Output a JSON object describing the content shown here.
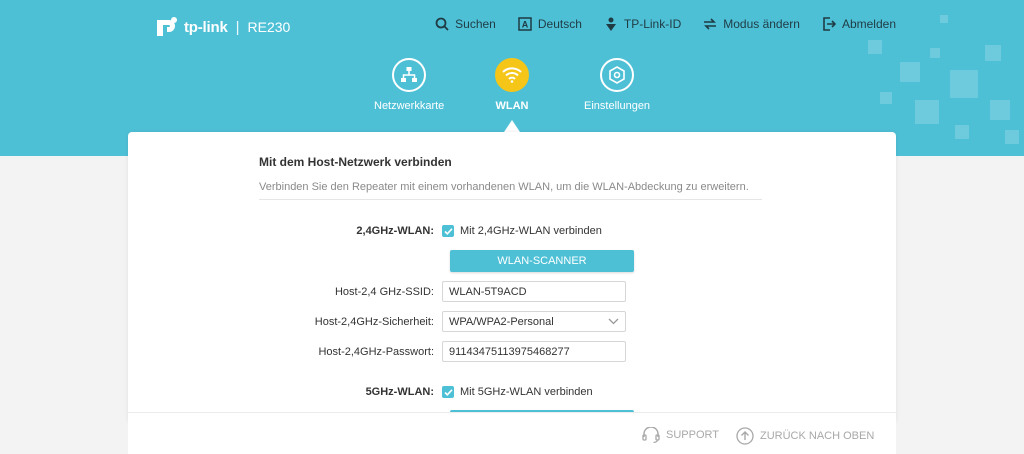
{
  "brand": {
    "logo_text": "tp-link",
    "separator": "|",
    "model": "RE230"
  },
  "top_nav": [
    {
      "label": "Suchen",
      "icon": "search-icon"
    },
    {
      "label": "Deutsch",
      "icon": "language-icon"
    },
    {
      "label": "TP-Link-ID",
      "icon": "tplink-id-icon"
    },
    {
      "label": "Modus ändern",
      "icon": "mode-change-icon"
    },
    {
      "label": "Abmelden",
      "icon": "logout-icon"
    }
  ],
  "main_nav": [
    {
      "label": "Netzwerkkarte",
      "icon": "network-map-icon",
      "active": false
    },
    {
      "label": "WLAN",
      "icon": "wifi-icon",
      "active": true
    },
    {
      "label": "Einstellungen",
      "icon": "settings-icon",
      "active": false
    }
  ],
  "section": {
    "title": "Mit dem Host-Netzwerk verbinden",
    "description": "Verbinden Sie den Repeater mit einem vorhandenen WLAN, um die WLAN-Abdeckung zu erweitern."
  },
  "band24": {
    "label": "2,4GHz-WLAN:",
    "checkbox_label": "Mit 2,4GHz-WLAN verbinden",
    "checked": true,
    "scanner_button": "WLAN-SCANNER",
    "ssid_label": "Host-2,4 GHz-SSID:",
    "ssid_value": "WLAN-5T9ACD",
    "security_label": "Host-2,4GHz-Sicherheit:",
    "security_value": "WPA/WPA2-Personal",
    "password_label": "Host-2,4GHz-Passwort:",
    "password_value": "91143475113975468277"
  },
  "band5": {
    "label": "5GHz-WLAN:",
    "checkbox_label": "Mit 5GHz-WLAN verbinden",
    "checked": true
  },
  "footer": {
    "support": "SUPPORT",
    "back_to_top": "ZURÜCK NACH OBEN"
  },
  "colors": {
    "accent": "#4ec0d6",
    "active_nav": "#f5c518"
  }
}
